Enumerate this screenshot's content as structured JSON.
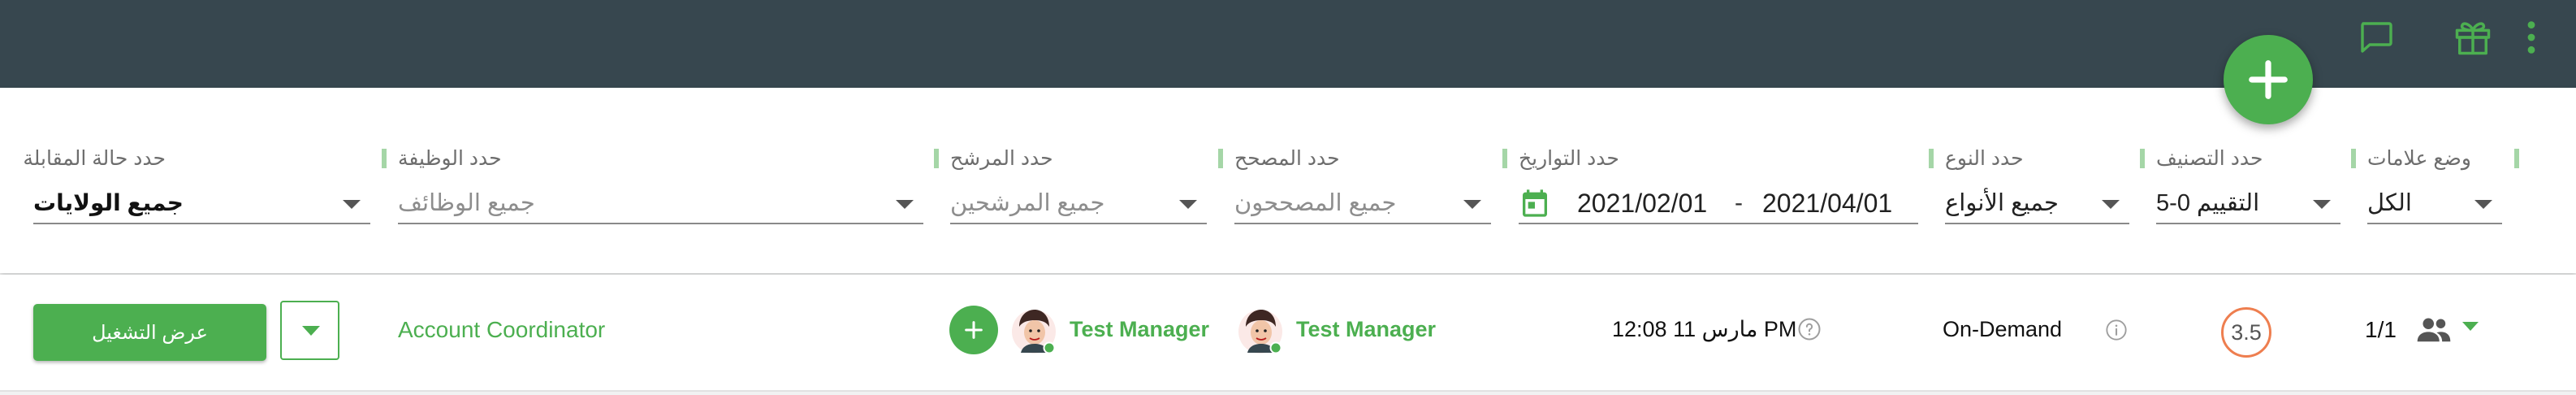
{
  "topbar": {
    "icons": [
      "chat-bubble-icon",
      "gift-icon",
      "more-vert-icon"
    ],
    "fab_label": "+"
  },
  "filters": {
    "interview_status": {
      "label": "حدد حالة المقابلة",
      "value": "جميع الولايات"
    },
    "job": {
      "label": "حدد الوظيفة",
      "placeholder": "جميع الوظائف"
    },
    "candidate": {
      "label": "حدد المرشح",
      "placeholder": "جميع المرشحين"
    },
    "reviewer": {
      "label": "حدد المصحح",
      "placeholder": "جميع المصححون"
    },
    "dates": {
      "label": "حدد التواريخ",
      "from": "2021/02/01",
      "separator": "-",
      "to": "2021/04/01"
    },
    "type": {
      "label": "حدد النوع",
      "value": "جميع الأنواع"
    },
    "rating": {
      "label": "حدد التصنيف",
      "value": "التقييم 0-5"
    },
    "flags": {
      "label": "وضع علامات",
      "value": "الكل"
    }
  },
  "row": {
    "run_button": "عرض التشغيل",
    "job_title": "Account Coordinator",
    "candidate_name": "Test Manager",
    "reviewer_name": "Test Manager",
    "datetime": "مارس 11 12:08 PM",
    "interview_type": "On-Demand",
    "score": "3.5",
    "count": "1/1"
  },
  "colors": {
    "topbar": "#37474f",
    "accent_green": "#4caf50",
    "score_ring": "#ee7e4f",
    "filter_marker": "#a5d6a7"
  }
}
